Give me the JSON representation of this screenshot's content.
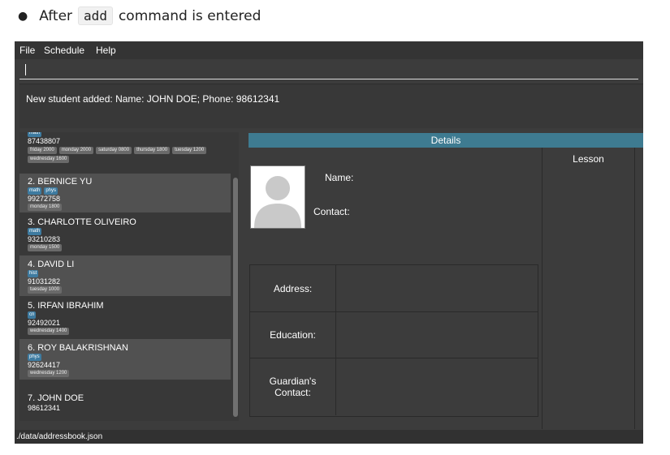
{
  "caption": {
    "before": "After",
    "code": "add",
    "after": "command is entered"
  },
  "menu": {
    "file": "File",
    "schedule": "Schedule",
    "help": "Help"
  },
  "command_input": {
    "value": ""
  },
  "result_message": "New student added: Name: JOHN DOE; Phone: 98612341",
  "students": [
    {
      "name": "",
      "phone": "87438807",
      "tags": [
        "math"
      ],
      "schedule": [
        "friday 2000",
        "monday 2000",
        "saturday 0800",
        "thursday 1800",
        "tuesday 1200",
        "wednesday 1600"
      ]
    },
    {
      "name": "2.  BERNICE YU",
      "phone": "99272758",
      "tags": [
        "math",
        "phys"
      ],
      "schedule": [
        "monday 1800"
      ]
    },
    {
      "name": "3.  CHARLOTTE OLIVEIRO",
      "phone": "93210283",
      "tags": [
        "math"
      ],
      "schedule": [
        "monday 1500"
      ]
    },
    {
      "name": "4.  DAVID LI",
      "phone": "91031282",
      "tags": [
        "hist"
      ],
      "schedule": [
        "tuesday 1000"
      ]
    },
    {
      "name": "5.  IRFAN IBRAHIM",
      "phone": "92492021",
      "tags": [
        "cn"
      ],
      "schedule": [
        "wednesday 1400"
      ]
    },
    {
      "name": "6.  ROY BALAKRISHNAN",
      "phone": "92624417",
      "tags": [
        "phys"
      ],
      "schedule": [
        "wednesday 1200"
      ]
    },
    {
      "name": "7.  JOHN DOE",
      "phone": "98612341",
      "tags": [],
      "schedule": []
    }
  ],
  "details": {
    "header": "Details",
    "name_label": "Name:",
    "contact_label": "Contact:",
    "address_label": "Address:",
    "education_label": "Education:",
    "guardian_label": "Guardian's\nContact:",
    "lesson_label": "Lesson"
  },
  "status_bar": "./data/addressbook.json",
  "colors": {
    "accent": "#3e7b91",
    "tag": "#3e7ba0",
    "background": "#3c3c3c"
  }
}
